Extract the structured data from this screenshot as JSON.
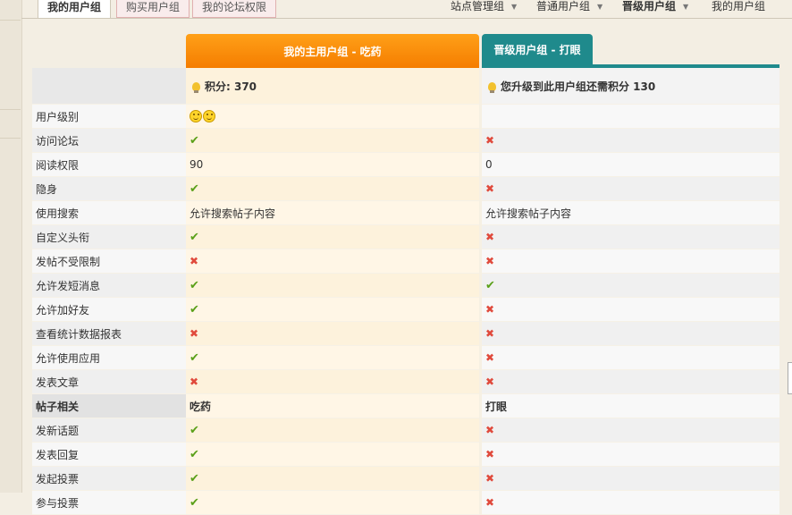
{
  "tabs": [
    {
      "label": "我的用户组",
      "active": true
    },
    {
      "label": "购买用户组",
      "active": false
    },
    {
      "label": "我的论坛权限",
      "active": false
    }
  ],
  "nav": [
    {
      "label": "站点管理组",
      "bold": false
    },
    {
      "label": "普通用户组",
      "bold": false
    },
    {
      "label": "晋级用户组",
      "bold": true
    },
    {
      "label": "我的用户组",
      "bold": false
    }
  ],
  "columns": {
    "main": {
      "header": "我的主用户组 - 吃药",
      "points": "积分: 370"
    },
    "target": {
      "header": "晋级用户组 - 打眼",
      "points": "您升级到此用户组还需积分 130"
    }
  },
  "colors": {
    "main_header": "#f57d00",
    "target_header": "#1f8a8c",
    "check": "#5aa019",
    "cross": "#e04a3c"
  },
  "rows": [
    {
      "label": "用户级别",
      "main": "face2",
      "target": ""
    },
    {
      "label": "访问论坛",
      "main": "yes",
      "target": "no"
    },
    {
      "label": "阅读权限",
      "main": "90",
      "target": "0"
    },
    {
      "label": "隐身",
      "main": "yes",
      "target": "no"
    },
    {
      "label": "使用搜索",
      "main": "允许搜索帖子内容",
      "target": "允许搜索帖子内容"
    },
    {
      "label": "自定义头衔",
      "main": "yes",
      "target": "no"
    },
    {
      "label": "发帖不受限制",
      "main": "no",
      "target": "no"
    },
    {
      "label": "允许发短消息",
      "main": "yes",
      "target": "yes"
    },
    {
      "label": "允许加好友",
      "main": "yes",
      "target": "no"
    },
    {
      "label": "查看统计数据报表",
      "main": "no",
      "target": "no"
    },
    {
      "label": "允许使用应用",
      "main": "yes",
      "target": "no"
    },
    {
      "label": "发表文章",
      "main": "no",
      "target": "no"
    },
    {
      "label": "帖子相关",
      "main": "吃药",
      "target": "打眼",
      "section": true
    },
    {
      "label": "发新话题",
      "main": "yes",
      "target": "no"
    },
    {
      "label": "发表回复",
      "main": "yes",
      "target": "no"
    },
    {
      "label": "发起投票",
      "main": "yes",
      "target": "no"
    },
    {
      "label": "参与投票",
      "main": "yes",
      "target": "no"
    }
  ]
}
